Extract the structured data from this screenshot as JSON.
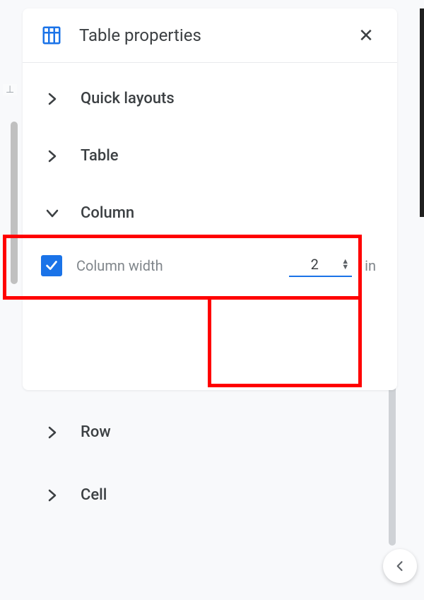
{
  "header": {
    "title": "Table properties"
  },
  "sections": {
    "quick_layouts": "Quick layouts",
    "table": "Table",
    "column": "Column",
    "row": "Row",
    "cell": "Cell"
  },
  "column_width": {
    "label": "Column width",
    "value": "2",
    "unit": "in",
    "checked": true
  },
  "colors": {
    "accent": "#1a73e8",
    "highlight": "#ff0000"
  }
}
